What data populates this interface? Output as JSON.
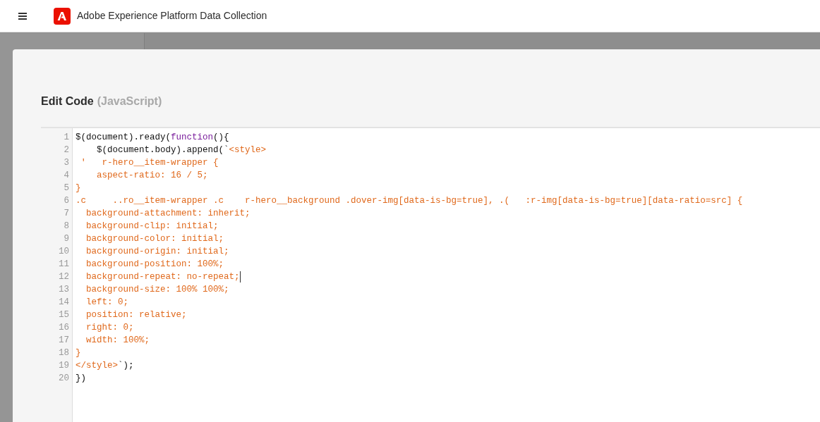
{
  "header": {
    "title": "Adobe Experience Platform Data Collection"
  },
  "dialog": {
    "title": "Edit Code",
    "language": "(JavaScript)",
    "editor": {
      "lines": [
        {
          "number": "1",
          "cursor": false,
          "segments": [
            {
              "kind": "plain",
              "text": "$(document).ready("
            },
            {
              "kind": "keyword",
              "text": "function"
            },
            {
              "kind": "plain",
              "text": "(){"
            }
          ]
        },
        {
          "number": "2",
          "cursor": false,
          "segments": [
            {
              "kind": "plain",
              "text": "    $(document.body).append(`"
            },
            {
              "kind": "string",
              "text": "<style>"
            }
          ]
        },
        {
          "number": "3",
          "cursor": false,
          "segments": [
            {
              "kind": "string",
              "text": " '   r-hero__item-wrapper {"
            }
          ]
        },
        {
          "number": "4",
          "cursor": false,
          "segments": [
            {
              "kind": "string",
              "text": "    aspect-ratio: 16 / 5;"
            }
          ]
        },
        {
          "number": "5",
          "cursor": false,
          "segments": [
            {
              "kind": "string",
              "text": "}"
            }
          ]
        },
        {
          "number": "6",
          "cursor": false,
          "segments": [
            {
              "kind": "string",
              "text": ".c     ..ro__item-wrapper .c    r-hero__background .dover-img[data-is-bg=true], .(   :r-img[data-is-bg=true][data-ratio=src] {"
            }
          ]
        },
        {
          "number": "7",
          "cursor": false,
          "segments": [
            {
              "kind": "string",
              "text": "  background-attachment: inherit;"
            }
          ]
        },
        {
          "number": "8",
          "cursor": false,
          "segments": [
            {
              "kind": "string",
              "text": "  background-clip: initial;"
            }
          ]
        },
        {
          "number": "9",
          "cursor": false,
          "segments": [
            {
              "kind": "string",
              "text": "  background-color: initial;"
            }
          ]
        },
        {
          "number": "10",
          "cursor": false,
          "segments": [
            {
              "kind": "string",
              "text": "  background-origin: initial;"
            }
          ]
        },
        {
          "number": "11",
          "cursor": false,
          "segments": [
            {
              "kind": "string",
              "text": "  background-position: 100%;"
            }
          ]
        },
        {
          "number": "12",
          "cursor": true,
          "segments": [
            {
              "kind": "string",
              "text": "  background-repeat: no-repeat;"
            }
          ]
        },
        {
          "number": "13",
          "cursor": false,
          "segments": [
            {
              "kind": "string",
              "text": "  background-size: 100% 100%;"
            }
          ]
        },
        {
          "number": "14",
          "cursor": false,
          "segments": [
            {
              "kind": "string",
              "text": "  left: 0;"
            }
          ]
        },
        {
          "number": "15",
          "cursor": false,
          "segments": [
            {
              "kind": "string",
              "text": "  position: relative;"
            }
          ]
        },
        {
          "number": "16",
          "cursor": false,
          "segments": [
            {
              "kind": "string",
              "text": "  right: 0;"
            }
          ]
        },
        {
          "number": "17",
          "cursor": false,
          "segments": [
            {
              "kind": "string",
              "text": "  width: 100%;"
            }
          ]
        },
        {
          "number": "18",
          "cursor": false,
          "segments": [
            {
              "kind": "string",
              "text": "}"
            }
          ]
        },
        {
          "number": "19",
          "cursor": false,
          "segments": [
            {
              "kind": "string",
              "text": "</style>"
            },
            {
              "kind": "plain",
              "text": "`);"
            }
          ]
        },
        {
          "number": "20",
          "cursor": false,
          "segments": [
            {
              "kind": "plain",
              "text": "})"
            }
          ]
        }
      ]
    }
  }
}
